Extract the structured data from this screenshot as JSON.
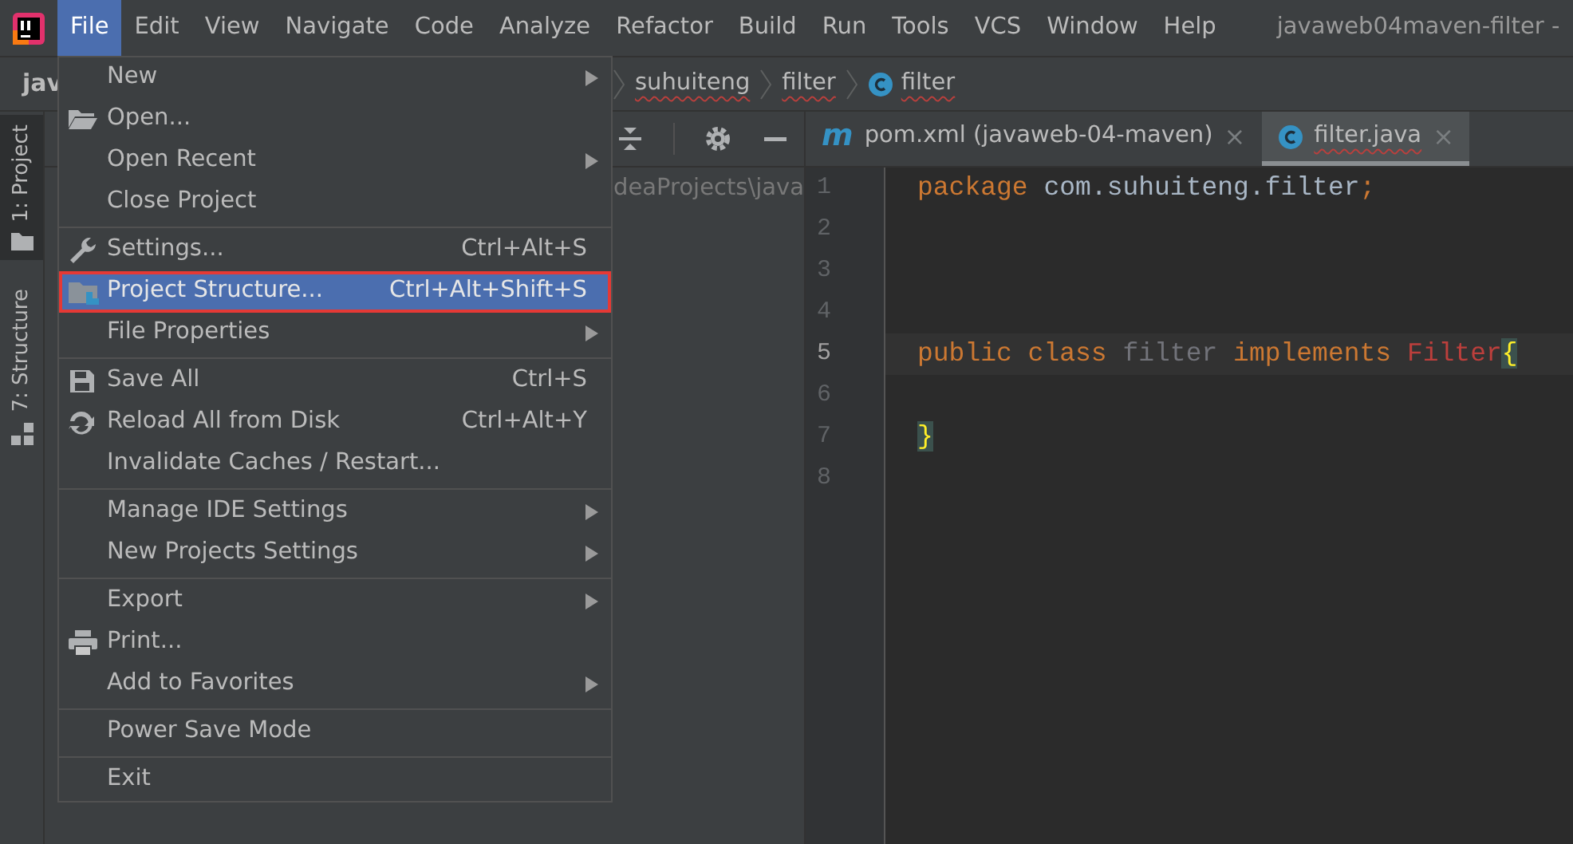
{
  "menu_bar": {
    "items": [
      {
        "label": "File",
        "selected": true
      },
      {
        "label": "Edit",
        "selected": false
      },
      {
        "label": "View",
        "selected": false
      },
      {
        "label": "Navigate",
        "selected": false
      },
      {
        "label": "Code",
        "selected": false
      },
      {
        "label": "Analyze",
        "selected": false
      },
      {
        "label": "Refactor",
        "selected": false
      },
      {
        "label": "Build",
        "selected": false
      },
      {
        "label": "Run",
        "selected": false
      },
      {
        "label": "Tools",
        "selected": false
      },
      {
        "label": "VCS",
        "selected": false
      },
      {
        "label": "Window",
        "selected": false
      },
      {
        "label": "Help",
        "selected": false
      }
    ],
    "window_title": "javaweb04maven-filter -"
  },
  "navigation_bar": {
    "project": "jav",
    "crumbs": [
      {
        "label": "suhuiteng",
        "kind": "folder",
        "misspelled": true
      },
      {
        "label": "filter",
        "kind": "folder",
        "misspelled": true
      },
      {
        "label": "filter",
        "kind": "class",
        "misspelled": true
      }
    ]
  },
  "tool_stripe": [
    {
      "label": "1: Project",
      "kind": "project",
      "selected": true
    },
    {
      "label": "7: Structure",
      "kind": "structure",
      "selected": false
    }
  ],
  "project_panel": {
    "path": "deaProjects\\java"
  },
  "editor": {
    "tabs": [
      {
        "label": "pom.xml (javaweb-04-maven)",
        "kind": "maven",
        "icon_text": "m",
        "selected": false,
        "misspelled": false,
        "close": "×"
      },
      {
        "label": "filter.java",
        "kind": "class",
        "selected": true,
        "misspelled": true,
        "close": "×"
      }
    ],
    "lines": [
      {
        "number": "1",
        "current": false,
        "tokens": [
          {
            "text": "package",
            "kind": "keyword"
          },
          {
            "text": " com.suhuiteng.filter",
            "kind": "plain"
          },
          {
            "text": ";",
            "kind": "keyword"
          }
        ]
      },
      {
        "number": "2",
        "current": false
      },
      {
        "number": "3",
        "current": false
      },
      {
        "number": "4",
        "current": false
      },
      {
        "number": "5",
        "current": true,
        "tokens": [
          {
            "text": "public class",
            "kind": "keyword"
          },
          {
            "text": " filter",
            "kind": "unused"
          },
          {
            "text": " implements",
            "kind": "keyword"
          },
          {
            "text": " Filter",
            "kind": "error"
          },
          {
            "text": "{",
            "kind": "brace"
          }
        ]
      },
      {
        "number": "6",
        "current": false
      },
      {
        "number": "7",
        "current": false,
        "tokens": [
          {
            "text": "}",
            "kind": "brace"
          }
        ]
      },
      {
        "number": "8",
        "current": false
      }
    ]
  },
  "file_menu": {
    "groups": [
      {
        "items": [
          {
            "label": "New",
            "kind": "plain",
            "submenu": true,
            "selected": false,
            "outlined": false
          },
          {
            "label": "Open...",
            "kind": "open",
            "submenu": false,
            "selected": false,
            "outlined": false
          },
          {
            "label": "Open Recent",
            "kind": "plain",
            "submenu": true,
            "selected": false,
            "outlined": false
          },
          {
            "label": "Close Project",
            "kind": "plain",
            "submenu": false,
            "selected": false,
            "outlined": false
          }
        ]
      },
      {
        "items": [
          {
            "label": "Settings...",
            "kind": "settings",
            "shortcut": "Ctrl+Alt+S",
            "submenu": false,
            "selected": false,
            "outlined": false
          },
          {
            "label": "Project Structure...",
            "kind": "structure",
            "shortcut": "Ctrl+Alt+Shift+S",
            "submenu": false,
            "selected": true,
            "outlined": true
          },
          {
            "label": "File Properties",
            "kind": "plain",
            "submenu": true,
            "selected": false,
            "outlined": false
          }
        ]
      },
      {
        "items": [
          {
            "label": "Save All",
            "kind": "save",
            "shortcut": "Ctrl+S",
            "submenu": false,
            "selected": false,
            "outlined": false
          },
          {
            "label": "Reload All from Disk",
            "kind": "reload",
            "shortcut": "Ctrl+Alt+Y",
            "submenu": false,
            "selected": false,
            "outlined": false
          },
          {
            "label": "Invalidate Caches / Restart...",
            "kind": "plain",
            "submenu": false,
            "selected": false,
            "outlined": false
          }
        ]
      },
      {
        "items": [
          {
            "label": "Manage IDE Settings",
            "kind": "plain",
            "submenu": true,
            "selected": false,
            "outlined": false
          },
          {
            "label": "New Projects Settings",
            "kind": "plain",
            "submenu": true,
            "selected": false,
            "outlined": false
          }
        ]
      },
      {
        "items": [
          {
            "label": "Export",
            "kind": "plain",
            "submenu": true,
            "selected": false,
            "outlined": false
          },
          {
            "label": "Print...",
            "kind": "print",
            "submenu": false,
            "selected": false,
            "outlined": false
          },
          {
            "label": "Add to Favorites",
            "kind": "plain",
            "submenu": true,
            "selected": false,
            "outlined": false
          }
        ]
      },
      {
        "items": [
          {
            "label": "Power Save Mode",
            "kind": "plain",
            "submenu": false,
            "selected": false,
            "outlined": false
          }
        ]
      },
      {
        "items": [
          {
            "label": "Exit",
            "kind": "plain",
            "submenu": false,
            "selected": false,
            "outlined": false
          }
        ]
      }
    ]
  }
}
